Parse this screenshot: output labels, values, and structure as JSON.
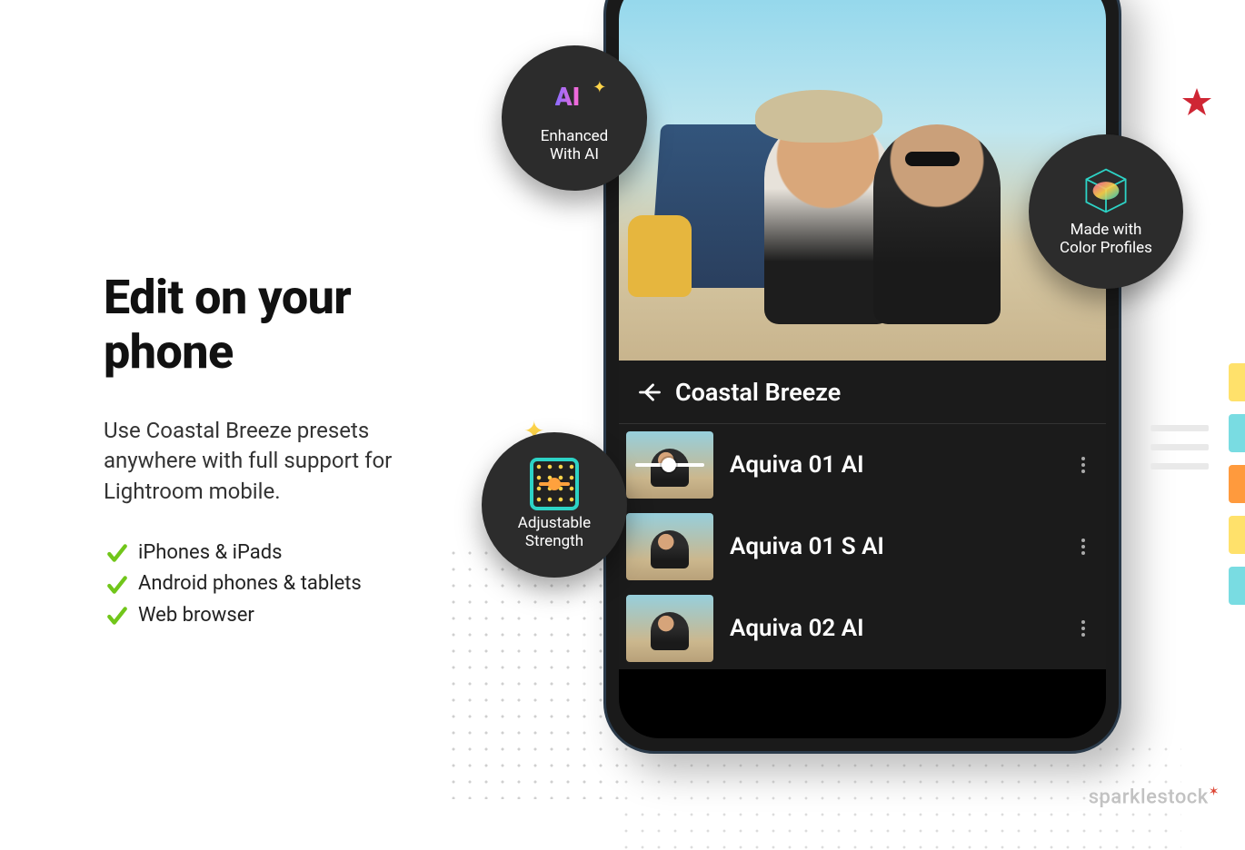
{
  "headline": "Edit on your phone",
  "body": "Use Coastal Breeze presets anywhere with full support for Lightroom mobile.",
  "checks": [
    "iPhones & iPads",
    "Android phones & tablets",
    "Web browser"
  ],
  "app": {
    "title": "Coastal Breeze",
    "presets": [
      "Aquiva  01 AI",
      "Aquiva  01 S AI",
      "Aquiva  02 AI"
    ]
  },
  "badges": {
    "ai_line1": "Enhanced",
    "ai_line2": "With AI",
    "ai_mark": "AI",
    "profiles_line1": "Made with",
    "profiles_line2": "Color Profiles",
    "strength_line1": "Adjustable",
    "strength_line2": "Strength"
  },
  "watermark": "sparklestock",
  "colors": {
    "tabs": [
      "#ffe16b",
      "#79dce2",
      "#ff9a3d",
      "#ffe16b",
      "#79dce2"
    ]
  }
}
